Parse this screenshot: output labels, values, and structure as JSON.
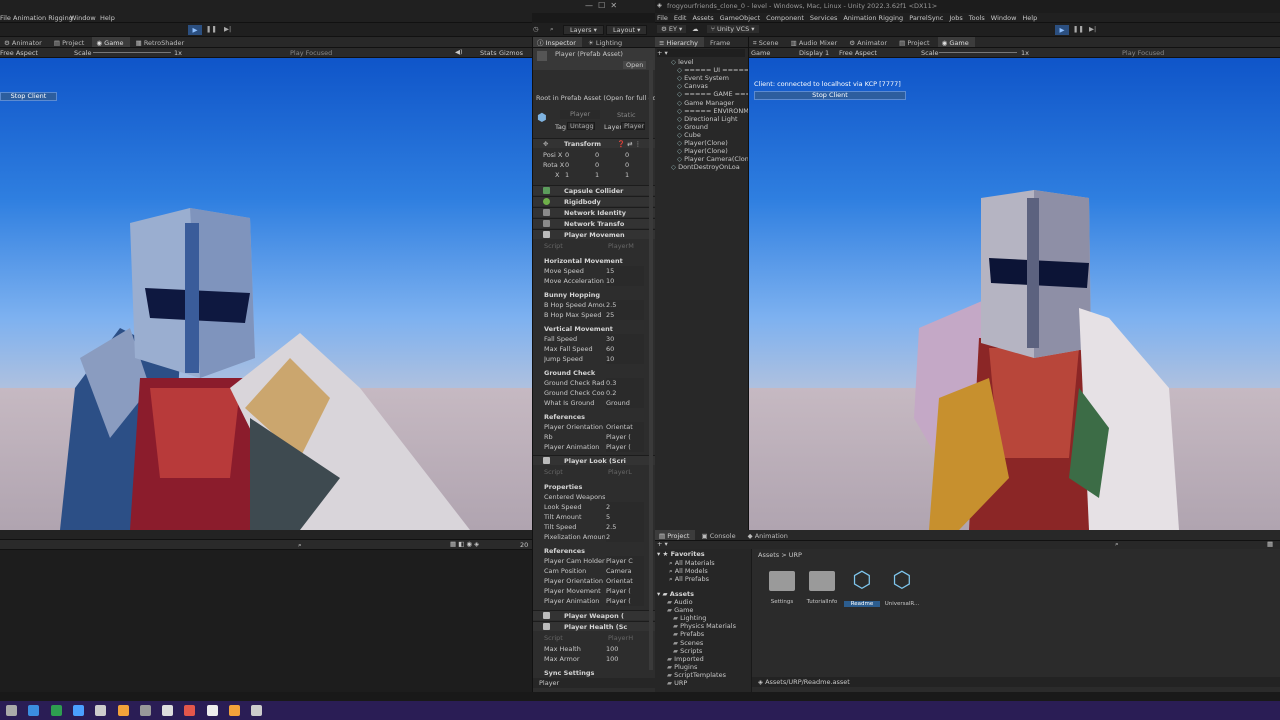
{
  "left_editor": {
    "menu": [
      "File",
      "Animation Rigging",
      "Window",
      "Help"
    ],
    "tabs": [
      "Animator",
      "Project",
      "Game",
      "RetroShader"
    ],
    "game_toolbar": {
      "aspect": "Free Aspect",
      "scale_label": "Scale",
      "scale_value": "1x",
      "play_focused": "Play Focused",
      "stats": "Stats",
      "gizmos": "Gizmos"
    },
    "stop_client": "Stop Client",
    "layers": "Layers",
    "layout": "Layout",
    "bottom_count": "20"
  },
  "inspector": {
    "tabs": [
      "Inspector",
      "Lighting"
    ],
    "prefab_title": "Player (Prefab Asset)",
    "open": "Open",
    "root_note": "Root in Prefab Asset (Open for full editi",
    "object_name": "Player",
    "static": "Static",
    "tag_label": "Tag",
    "tag_value": "Untagg",
    "layer_label": "Layer",
    "layer_value": "Player",
    "transform": {
      "title": "Transform",
      "rows": [
        {
          "label": "Posi X",
          "x": "0",
          "y": "0",
          "z": "0"
        },
        {
          "label": "Rota X",
          "x": "0",
          "y": "0",
          "z": "0"
        },
        {
          "label": "X",
          "x": "1",
          "y": "1",
          "z": "1"
        }
      ]
    },
    "components": [
      "Capsule Collider",
      "Rigidbody",
      "Network Identity",
      "Network Transfo",
      "Player Movemen"
    ],
    "movement": {
      "script_label": "Script",
      "script_value": "PlayerM",
      "sections": [
        {
          "title": "Horizontal Movement",
          "fields": [
            {
              "label": "Move Speed",
              "value": "15"
            },
            {
              "label": "Move Acceleration",
              "value": "10"
            }
          ]
        },
        {
          "title": "Bunny Hopping",
          "fields": [
            {
              "label": "B Hop Speed Amount",
              "value": "2.5"
            },
            {
              "label": "B Hop Max Speed",
              "value": "25"
            }
          ]
        },
        {
          "title": "Vertical Movement",
          "fields": [
            {
              "label": "Fall Speed",
              "value": "30"
            },
            {
              "label": "Max Fall Speed",
              "value": "60"
            },
            {
              "label": "Jump Speed",
              "value": "10"
            }
          ]
        },
        {
          "title": "Ground Check",
          "fields": [
            {
              "label": "Ground Check Radiu",
              "value": "0.3"
            },
            {
              "label": "Ground Check Coold",
              "value": "0.2"
            },
            {
              "label": "What Is Ground",
              "value": "Ground"
            }
          ]
        },
        {
          "title": "References",
          "fields": [
            {
              "label": "Player Orientation",
              "value": "Orientat"
            },
            {
              "label": "Rb",
              "value": "Player ("
            },
            {
              "label": "Player Animation",
              "value": "Player ("
            }
          ]
        }
      ]
    },
    "look": {
      "title": "Player Look (Scri",
      "script_label": "Script",
      "script_value": "PlayerL",
      "sections": [
        {
          "title": "Properties",
          "fields": [
            {
              "label": "Centered Weapons",
              "value": ""
            },
            {
              "label": "Look Speed",
              "value": "2"
            },
            {
              "label": "Tilt Amount",
              "value": "5"
            },
            {
              "label": "Tilt Speed",
              "value": "2.5"
            },
            {
              "label": "Pixelization Amount",
              "value": "2"
            }
          ]
        },
        {
          "title": "References",
          "fields": [
            {
              "label": "Player Cam Holder Pi",
              "value": "Player C"
            },
            {
              "label": "Cam Position",
              "value": "Camera"
            },
            {
              "label": "Player Orientation",
              "value": "Orientat"
            },
            {
              "label": "Player Movement",
              "value": "Player ("
            },
            {
              "label": "Player Animation",
              "value": "Player ("
            }
          ]
        }
      ]
    },
    "weapon": "Player Weapon (",
    "health": {
      "title": "Player Health (Sc",
      "script_label": "Script",
      "script_value": "PlayerH",
      "fields": [
        {
          "label": "Max Health",
          "value": "100"
        },
        {
          "label": "Max Armor",
          "value": "100"
        }
      ]
    },
    "sync": "Sync Settings",
    "footer": "Player"
  },
  "right_editor": {
    "title": "frogyourfriends_clone_0 - level - Windows, Mac, Linux - Unity 2022.3.62f1 <DX11>",
    "menu": [
      "File",
      "Edit",
      "Assets",
      "GameObject",
      "Component",
      "Services",
      "Animation Rigging",
      "ParrelSync",
      "Jobs",
      "Tools",
      "Window",
      "Help"
    ],
    "account": "EY",
    "vcs": "Unity VCS",
    "hierarchy_tabs": [
      "Hierarchy",
      "Frame"
    ],
    "hierarchy": [
      {
        "text": "level",
        "depth": 0
      },
      {
        "text": "===== UI =====",
        "depth": 1
      },
      {
        "text": "Event System",
        "depth": 1
      },
      {
        "text": "Canvas",
        "depth": 1
      },
      {
        "text": "===== GAME =====",
        "depth": 1
      },
      {
        "text": "Game Manager",
        "depth": 1
      },
      {
        "text": "===== ENVIRONMENT",
        "depth": 1
      },
      {
        "text": "Directional Light",
        "depth": 1
      },
      {
        "text": "Ground",
        "depth": 1
      },
      {
        "text": "Cube",
        "depth": 1
      },
      {
        "text": "Player(Clone)",
        "depth": 1
      },
      {
        "text": "Player(Clone)",
        "depth": 1
      },
      {
        "text": "Player Camera(Clon",
        "depth": 1
      },
      {
        "text": "DontDestroyOnLoa",
        "depth": 0
      }
    ],
    "tabs": [
      "Scene",
      "Audio Mixer",
      "Animator",
      "Project",
      "Game"
    ],
    "game_toolbar": {
      "game": "Game",
      "display": "Display 1",
      "aspect": "Free Aspect",
      "scale_label": "Scale",
      "scale_value": "1x",
      "play_focused": "Play Focused"
    },
    "status": "Client: connected to localhost via KCP [7777]",
    "stop_client": "Stop Client",
    "bottom_tabs": [
      "Project",
      "Console",
      "Animation"
    ],
    "favorites": {
      "title": "Favorites",
      "items": [
        "All Materials",
        "All Models",
        "All Prefabs"
      ]
    },
    "assets_tree": {
      "title": "Assets",
      "items": [
        {
          "text": "Audio",
          "depth": 1
        },
        {
          "text": "Game",
          "depth": 1
        },
        {
          "text": "Lighting",
          "depth": 2
        },
        {
          "text": "Physics Materials",
          "depth": 2
        },
        {
          "text": "Prefabs",
          "depth": 2
        },
        {
          "text": "Scenes",
          "depth": 2
        },
        {
          "text": "Scripts",
          "depth": 2
        },
        {
          "text": "Imported",
          "depth": 1
        },
        {
          "text": "Plugins",
          "depth": 1
        },
        {
          "text": "ScriptTemplates",
          "depth": 1
        },
        {
          "text": "URP",
          "depth": 1
        }
      ]
    },
    "breadcrumb": [
      "Assets",
      "URP"
    ],
    "asset_items": [
      {
        "name": "Settings",
        "kind": "folder"
      },
      {
        "name": "TutorialInfo",
        "kind": "folder"
      },
      {
        "name": "Readme",
        "kind": "asset"
      },
      {
        "name": "UniversalR...",
        "kind": "asset"
      }
    ],
    "selected_path": "Assets/URP/Readme.asset"
  },
  "taskbar": {
    "icons": [
      "settings-icon",
      "vscode-icon",
      "excel-icon",
      "app-icon",
      "spider-icon",
      "fox-icon",
      "app2-icon",
      "obs-icon",
      "chrome-icon",
      "unity-icon",
      "fox2-icon",
      "spider2-icon"
    ]
  }
}
